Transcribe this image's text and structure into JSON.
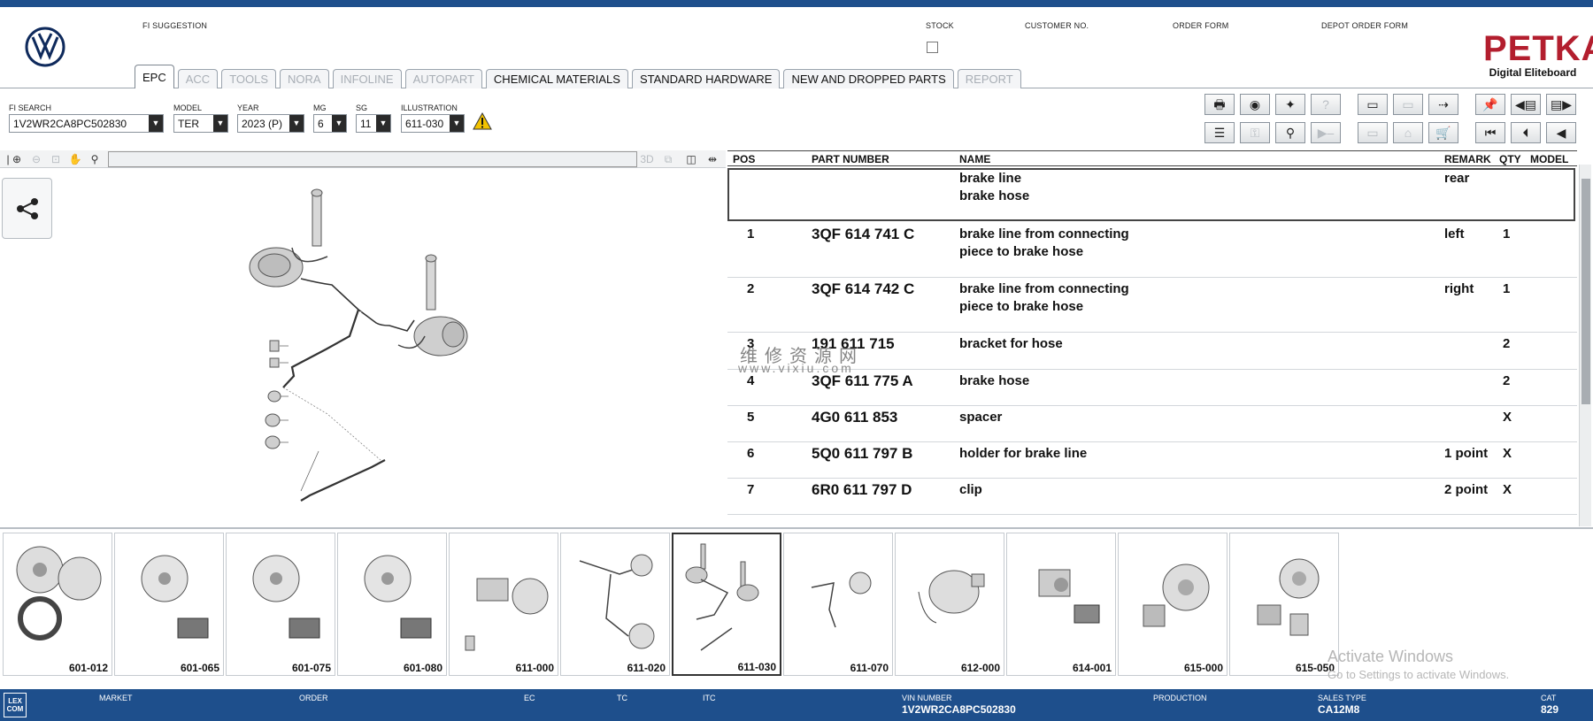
{
  "header": {
    "fi_suggestion": "FI SUGGESTION",
    "stock": "STOCK",
    "customer_no": "CUSTOMER NO.",
    "order_form": "ORDER FORM",
    "depot_order_form": "DEPOT ORDER FORM",
    "brand_word": "PETKA",
    "brand_sub": "Digital Eliteboard"
  },
  "tabs": [
    {
      "label": "EPC",
      "state": "active"
    },
    {
      "label": "ACC",
      "state": "disabled"
    },
    {
      "label": "TOOLS",
      "state": "disabled"
    },
    {
      "label": "NORA",
      "state": "disabled"
    },
    {
      "label": "INFOLINE",
      "state": "disabled"
    },
    {
      "label": "AUTOPART",
      "state": "disabled"
    },
    {
      "label": "CHEMICAL MATERIALS",
      "state": "enabled"
    },
    {
      "label": "STANDARD HARDWARE",
      "state": "enabled"
    },
    {
      "label": "NEW AND DROPPED PARTS",
      "state": "enabled"
    },
    {
      "label": "REPORT",
      "state": "disabled"
    }
  ],
  "selectors": {
    "fi_search": {
      "label": "FI SEARCH",
      "value": "1V2WR2CA8PC502830"
    },
    "model": {
      "label": "MODEL",
      "value": "TER"
    },
    "year": {
      "label": "YEAR",
      "value": "2023 (P)"
    },
    "mg": {
      "label": "MG",
      "value": "6"
    },
    "sg": {
      "label": "SG",
      "value": "11"
    },
    "illustration": {
      "label": "ILLUSTRATION",
      "value": "611-030"
    }
  },
  "parts_table": {
    "headers": {
      "pos": "POS",
      "part_number": "PART NUMBER",
      "name": "NAME",
      "remark": "REMARK",
      "qty": "QTY",
      "model": "MODEL"
    },
    "group_row": {
      "name_line1": "brake line",
      "name_line2": "brake hose",
      "remark": "rear"
    },
    "rows": [
      {
        "pos": "1",
        "part_number": "3QF 614 741 C",
        "name_line1": "brake line from connecting",
        "name_line2": "piece to brake hose",
        "remark": "left",
        "qty": "1"
      },
      {
        "pos": "2",
        "part_number": "3QF 614 742 C",
        "name_line1": "brake line from connecting",
        "name_line2": "piece to brake hose",
        "remark": "right",
        "qty": "1"
      },
      {
        "pos": "3",
        "part_number": "191 611 715",
        "name_line1": "bracket for hose",
        "name_line2": "",
        "remark": "",
        "qty": "2"
      },
      {
        "pos": "4",
        "part_number": "3QF 611 775 A",
        "name_line1": "brake hose",
        "name_line2": "",
        "remark": "",
        "qty": "2"
      },
      {
        "pos": "5",
        "part_number": "4G0 611 853",
        "name_line1": "spacer",
        "name_line2": "",
        "remark": "",
        "qty": "X"
      },
      {
        "pos": "6",
        "part_number": "5Q0 611 797 B",
        "name_line1": "holder for brake line",
        "name_line2": "",
        "remark": "1 point",
        "qty": "X"
      },
      {
        "pos": "7",
        "part_number": "6R0 611 797 D",
        "name_line1": "clip",
        "name_line2": "",
        "remark": "2 point",
        "qty": "X"
      }
    ]
  },
  "thumbnails": [
    "601-012",
    "601-065",
    "601-075",
    "601-080",
    "611-000",
    "611-020",
    "611-030",
    "611-070",
    "612-000",
    "614-001",
    "615-000",
    "615-050"
  ],
  "active_thumbnail": "611-030",
  "watermark": {
    "line1": "维修资源网",
    "line2": "www.vixiu.com"
  },
  "activation": {
    "line1": "Activate Windows",
    "line2": "Go to Settings to activate Windows."
  },
  "statusbar": {
    "logo": "LEX COM",
    "market": "MARKET",
    "order": "ORDER",
    "ec": "EC",
    "tc": "TC",
    "itc": "ITC",
    "vin_label": "VIN NUMBER",
    "vin_value": "1V2WR2CA8PC502830",
    "production": "PRODUCTION",
    "sales_type_label": "SALES TYPE",
    "sales_type_value": "CA12M8",
    "cat_label": "CAT",
    "cat_value": "829"
  },
  "colors": {
    "brand_blue": "#1e4f8c",
    "petka_red": "#b31e2e",
    "warning_yellow": "#f2c200"
  }
}
